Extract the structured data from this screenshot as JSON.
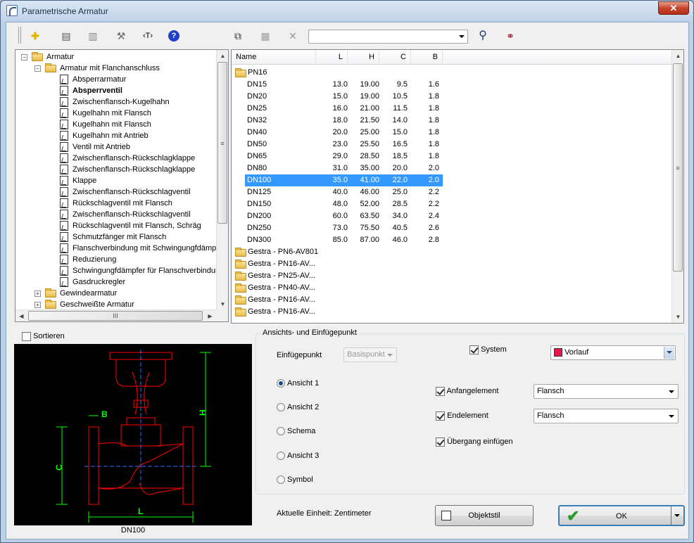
{
  "window": {
    "title": "Parametrische Armatur",
    "close": "✕"
  },
  "toolbar": {
    "buttons": [
      {
        "name": "new-icon",
        "glyph": "✚"
      },
      {
        "name": "properties-icon",
        "glyph": "▤"
      },
      {
        "name": "list-icon",
        "glyph": "▥"
      },
      {
        "name": "tools-icon",
        "glyph": "⚒"
      },
      {
        "name": "text-icon",
        "glyph": "‹T›"
      },
      {
        "name": "help-icon",
        "glyph": "?"
      },
      {
        "name": "copy-icon",
        "glyph": "⧉"
      },
      {
        "name": "paste-icon",
        "glyph": "▦"
      },
      {
        "name": "delete-icon",
        "glyph": "✕"
      },
      {
        "name": "search-icon",
        "glyph": "⚲"
      },
      {
        "name": "find-replace-icon",
        "glyph": "⚭"
      }
    ],
    "search_value": ""
  },
  "tree": {
    "items": [
      {
        "label": "Armatur",
        "level": 0,
        "type": "folder",
        "exp": "−"
      },
      {
        "label": "Armatur mit Flanchanschluss",
        "level": 1,
        "type": "folder",
        "exp": "−"
      },
      {
        "label": "Absperrarmatur",
        "level": 2,
        "type": "doc"
      },
      {
        "label": "Absperrventil",
        "level": 2,
        "type": "doc",
        "bold": true
      },
      {
        "label": "Zwischenflansch-Kugelhahn",
        "level": 2,
        "type": "doc"
      },
      {
        "label": "Kugelhahn mit Flansch",
        "level": 2,
        "type": "doc"
      },
      {
        "label": "Kugelhahn mit Flansch",
        "level": 2,
        "type": "doc"
      },
      {
        "label": "Kugelhahn mit Antrieb",
        "level": 2,
        "type": "doc"
      },
      {
        "label": "Ventil mit Antrieb",
        "level": 2,
        "type": "doc"
      },
      {
        "label": "Zwischenflansch-Rückschlagklappe",
        "level": 2,
        "type": "doc"
      },
      {
        "label": "Zwischenflansch-Rückschlagklappe",
        "level": 2,
        "type": "doc"
      },
      {
        "label": "Klappe",
        "level": 2,
        "type": "doc"
      },
      {
        "label": "Zwischenflansch-Rückschlagventil",
        "level": 2,
        "type": "doc"
      },
      {
        "label": "Rückschlagventil mit Flansch",
        "level": 2,
        "type": "doc"
      },
      {
        "label": "Zwischenflansch-Rückschlagventil",
        "level": 2,
        "type": "doc"
      },
      {
        "label": "Rückschlagventil mit Flansch, Schräg",
        "level": 2,
        "type": "doc"
      },
      {
        "label": "Schmutzfänger mit Flansch",
        "level": 2,
        "type": "doc"
      },
      {
        "label": "Flanschverbindung mit Schwingungfdämpfer",
        "level": 2,
        "type": "doc"
      },
      {
        "label": "Reduzierung",
        "level": 2,
        "type": "doc"
      },
      {
        "label": "Schwingungfdämpfer für Flanschverbindung",
        "level": 2,
        "type": "doc"
      },
      {
        "label": "Gasdruckregler",
        "level": 2,
        "type": "doc"
      },
      {
        "label": "Gewindearmatur",
        "level": 1,
        "type": "folder",
        "exp": "+"
      },
      {
        "label": "Geschweißte Armatur",
        "level": 1,
        "type": "folder",
        "exp": "+"
      }
    ],
    "hscroll_thumb_label": "III",
    "vscroll_thumb_label": "≡"
  },
  "list": {
    "columns": [
      "Name",
      "L",
      "H",
      "C",
      "B"
    ],
    "group_label": "PN16",
    "rows": [
      {
        "name": "DN15",
        "L": "13.0",
        "H": "19.00",
        "C": "9.5",
        "B": "1.6"
      },
      {
        "name": "DN20",
        "L": "15.0",
        "H": "19.00",
        "C": "10.5",
        "B": "1.8"
      },
      {
        "name": "DN25",
        "L": "16.0",
        "H": "21.00",
        "C": "11.5",
        "B": "1.8"
      },
      {
        "name": "DN32",
        "L": "18.0",
        "H": "21.50",
        "C": "14.0",
        "B": "1.8"
      },
      {
        "name": "DN40",
        "L": "20.0",
        "H": "25.00",
        "C": "15.0",
        "B": "1.8"
      },
      {
        "name": "DN50",
        "L": "23.0",
        "H": "25.50",
        "C": "16.5",
        "B": "1.8"
      },
      {
        "name": "DN65",
        "L": "29.0",
        "H": "28.50",
        "C": "18.5",
        "B": "1.8"
      },
      {
        "name": "DN80",
        "L": "31.0",
        "H": "35.00",
        "C": "20.0",
        "B": "2.0"
      },
      {
        "name": "DN100",
        "L": "35.0",
        "H": "41.00",
        "C": "22.0",
        "B": "2.0",
        "selected": true
      },
      {
        "name": "DN125",
        "L": "40.0",
        "H": "46.00",
        "C": "25.0",
        "B": "2.2"
      },
      {
        "name": "DN150",
        "L": "48.0",
        "H": "52.00",
        "C": "28.5",
        "B": "2.2"
      },
      {
        "name": "DN200",
        "L": "60.0",
        "H": "63.50",
        "C": "34.0",
        "B": "2.4"
      },
      {
        "name": "DN250",
        "L": "73.0",
        "H": "75.50",
        "C": "40.5",
        "B": "2.6"
      },
      {
        "name": "DN300",
        "L": "85.0",
        "H": "87.00",
        "C": "46.0",
        "B": "2.8"
      }
    ],
    "other_groups": [
      "Gestra - PN6-AV801",
      "Gestra - PN16-AV...",
      "Gestra - PN25-AV...",
      "Gestra - PN40-AV...",
      "Gestra - PN16-AV...",
      "Gestra - PN16-AV..."
    ]
  },
  "preview": {
    "sortieren_label": "Sortieren",
    "caption": "DN100",
    "dim_labels": {
      "H": "H",
      "B": "B",
      "C": "C",
      "L": "L"
    },
    "colors": {
      "outline": "#ff0000",
      "centerline": "#3d6bff",
      "dimension": "#00ff00"
    }
  },
  "insert": {
    "group_title": "Ansichts- und Einfügepunkt",
    "einfuegepunkt_label": "Einfügepunkt",
    "einfuegepunkt_value": "Basispunkt",
    "system_label": "System",
    "system_checked": true,
    "system_value": "Vorlauf",
    "system_color": "#e8174a",
    "views": [
      {
        "label": "Ansicht 1",
        "checked": true
      },
      {
        "label": "Ansicht 2",
        "checked": false
      },
      {
        "label": "Schema",
        "checked": false
      },
      {
        "label": "Ansicht 3",
        "checked": false
      },
      {
        "label": "Symbol",
        "checked": false
      }
    ],
    "anfang_label": "Anfangelement",
    "anfang_value": "Flansch",
    "end_label": "Endelement",
    "end_value": "Flansch",
    "uebergang_label": "Übergang einfügen"
  },
  "footer": {
    "unit_text": "Aktuelle Einheit: Zentimeter",
    "objektstil_label": "Objektstil",
    "ok_label": "OK"
  }
}
